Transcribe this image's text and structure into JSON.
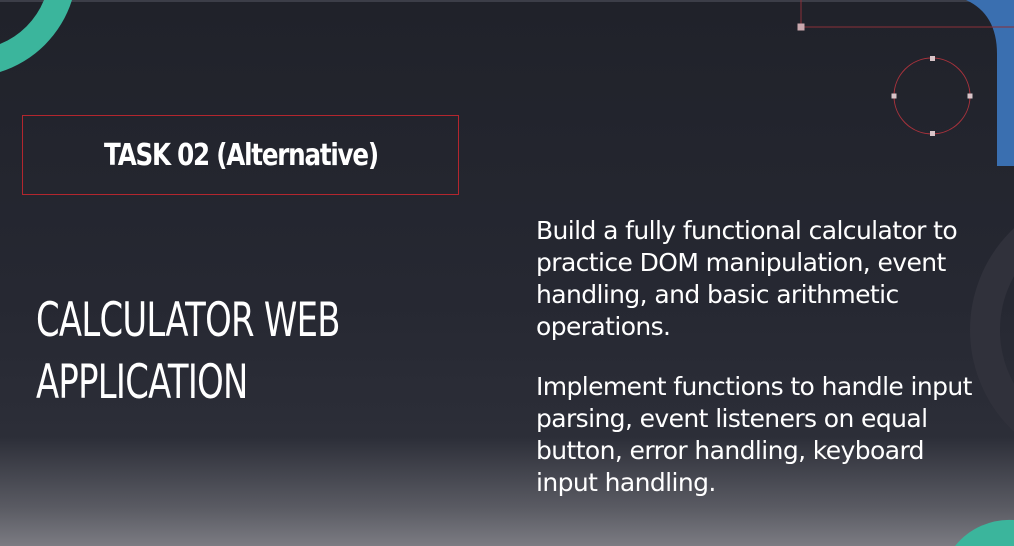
{
  "slide": {
    "task_title": "TASK 02 (Alternative)",
    "app_title_line1": "CALCULATOR WEB",
    "app_title_line2": "APPLICATION",
    "description_1": "Build a fully functional calculator to practice DOM manipulation, event handling, and basic arithmetic operations.",
    "description_2": "Implement functions to handle input parsing, event listeners on equal button, error handling, keyboard input handling."
  },
  "colors": {
    "background": "#23252e",
    "accent_red": "#b3262e",
    "accent_teal": "#3bb59c",
    "accent_blue": "#3a6fb0",
    "text": "#ffffff"
  }
}
